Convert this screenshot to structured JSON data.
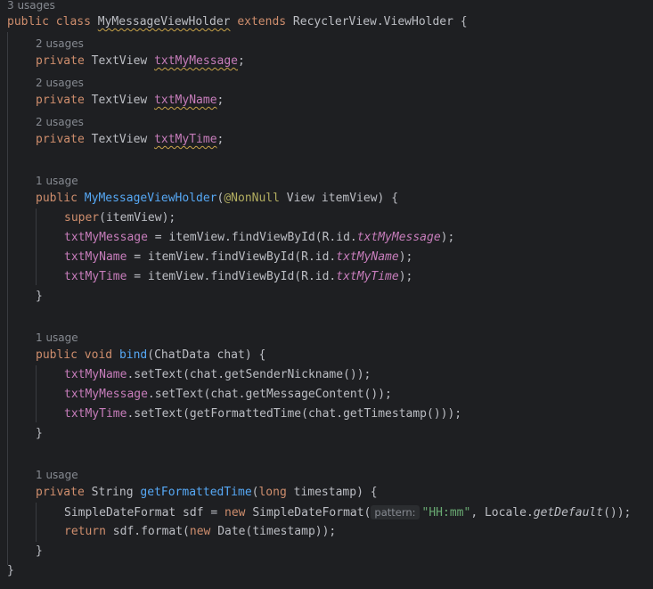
{
  "editor": {
    "language": "java",
    "colors": {
      "background": "#1e1f22",
      "text": "#bcbec4",
      "keyword": "#cf8e6d",
      "method_declaration": "#56a8f5",
      "field": "#c77dbb",
      "annotation": "#b3ae60",
      "string": "#6aab73",
      "inlay_hint": "#868a91",
      "indent_guide": "#393b40",
      "warning_underline": "#c8a34a"
    },
    "lines": [
      {
        "kind": "hint",
        "text": "3 usages"
      },
      {
        "kind": "code",
        "tokens": [
          {
            "t": "public",
            "c": "keyword"
          },
          {
            "t": " ",
            "c": "plain"
          },
          {
            "t": "class",
            "c": "keyword"
          },
          {
            "t": " ",
            "c": "plain"
          },
          {
            "t": "MyMessageViewHolder",
            "c": "type",
            "squiggle": true
          },
          {
            "t": " ",
            "c": "plain"
          },
          {
            "t": "extends",
            "c": "keyword"
          },
          {
            "t": " RecyclerView.ViewHolder {",
            "c": "plain"
          }
        ]
      },
      {
        "kind": "hint",
        "text": "2 usages"
      },
      {
        "kind": "code",
        "tokens": [
          {
            "t": "private",
            "c": "keyword"
          },
          {
            "t": " TextView ",
            "c": "plain"
          },
          {
            "t": "txtMyMessage",
            "c": "field",
            "squiggle": true
          },
          {
            "t": ";",
            "c": "plain"
          }
        ]
      },
      {
        "kind": "hint",
        "text": "2 usages"
      },
      {
        "kind": "code",
        "tokens": [
          {
            "t": "private",
            "c": "keyword"
          },
          {
            "t": " TextView ",
            "c": "plain"
          },
          {
            "t": "txtMyName",
            "c": "field",
            "squiggle": true
          },
          {
            "t": ";",
            "c": "plain"
          }
        ]
      },
      {
        "kind": "hint",
        "text": "2 usages"
      },
      {
        "kind": "code",
        "tokens": [
          {
            "t": "private",
            "c": "keyword"
          },
          {
            "t": " TextView ",
            "c": "plain"
          },
          {
            "t": "txtMyTime",
            "c": "field",
            "squiggle": true
          },
          {
            "t": ";",
            "c": "plain"
          }
        ]
      },
      {
        "kind": "hint",
        "text": "1 usage"
      },
      {
        "kind": "code",
        "tokens": [
          {
            "t": "public",
            "c": "keyword"
          },
          {
            "t": " ",
            "c": "plain"
          },
          {
            "t": "MyMessageViewHolder",
            "c": "method-decl"
          },
          {
            "t": "(",
            "c": "plain"
          },
          {
            "t": "@NonNull",
            "c": "annotation"
          },
          {
            "t": " View itemView) {",
            "c": "plain"
          }
        ]
      },
      {
        "kind": "code",
        "tokens": [
          {
            "t": "super",
            "c": "keyword"
          },
          {
            "t": "(itemView);",
            "c": "plain"
          }
        ]
      },
      {
        "kind": "code",
        "tokens": [
          {
            "t": "txtMyMessage",
            "c": "field"
          },
          {
            "t": " = itemView.findViewById(R.id.",
            "c": "plain"
          },
          {
            "t": "txtMyMessage",
            "c": "static-field"
          },
          {
            "t": ");",
            "c": "plain"
          }
        ]
      },
      {
        "kind": "code",
        "tokens": [
          {
            "t": "txtMyName",
            "c": "field"
          },
          {
            "t": " = itemView.findViewById(R.id.",
            "c": "plain"
          },
          {
            "t": "txtMyName",
            "c": "static-field"
          },
          {
            "t": ");",
            "c": "plain"
          }
        ]
      },
      {
        "kind": "code",
        "tokens": [
          {
            "t": "txtMyTime",
            "c": "field"
          },
          {
            "t": " = itemView.findViewById(R.id.",
            "c": "plain"
          },
          {
            "t": "txtMyTime",
            "c": "static-field"
          },
          {
            "t": ");",
            "c": "plain"
          }
        ]
      },
      {
        "kind": "code",
        "tokens": [
          {
            "t": "}",
            "c": "plain"
          }
        ]
      },
      {
        "kind": "hint",
        "text": "1 usage"
      },
      {
        "kind": "code",
        "tokens": [
          {
            "t": "public",
            "c": "keyword"
          },
          {
            "t": " ",
            "c": "plain"
          },
          {
            "t": "void",
            "c": "keyword"
          },
          {
            "t": " ",
            "c": "plain"
          },
          {
            "t": "bind",
            "c": "method-decl"
          },
          {
            "t": "(ChatData chat) {",
            "c": "plain"
          }
        ]
      },
      {
        "kind": "code",
        "tokens": [
          {
            "t": "txtMyName",
            "c": "field"
          },
          {
            "t": ".setText(chat.getSenderNickname());",
            "c": "plain"
          }
        ]
      },
      {
        "kind": "code",
        "tokens": [
          {
            "t": "txtMyMessage",
            "c": "field"
          },
          {
            "t": ".setText(chat.getMessageContent());",
            "c": "plain"
          }
        ]
      },
      {
        "kind": "code",
        "tokens": [
          {
            "t": "txtMyTime",
            "c": "field"
          },
          {
            "t": ".setText(getFormattedTime(chat.getTimestamp()));",
            "c": "plain"
          }
        ]
      },
      {
        "kind": "code",
        "tokens": [
          {
            "t": "}",
            "c": "plain"
          }
        ]
      },
      {
        "kind": "hint",
        "text": "1 usage"
      },
      {
        "kind": "code",
        "tokens": [
          {
            "t": "private",
            "c": "keyword"
          },
          {
            "t": " String ",
            "c": "plain"
          },
          {
            "t": "getFormattedTime",
            "c": "method-decl"
          },
          {
            "t": "(",
            "c": "plain"
          },
          {
            "t": "long",
            "c": "keyword"
          },
          {
            "t": " timestamp) {",
            "c": "plain"
          }
        ]
      },
      {
        "kind": "code",
        "tokens": [
          {
            "t": "SimpleDateFormat sdf = ",
            "c": "plain"
          },
          {
            "t": "new",
            "c": "keyword"
          },
          {
            "t": " SimpleDateFormat(",
            "c": "plain"
          },
          {
            "t": "pattern:",
            "c": "hint"
          },
          {
            "t": "\"HH:mm\"",
            "c": "string"
          },
          {
            "t": ", Locale.",
            "c": "plain"
          },
          {
            "t": "getDefault",
            "c": "static-call"
          },
          {
            "t": "());",
            "c": "plain"
          }
        ]
      },
      {
        "kind": "code",
        "tokens": [
          {
            "t": "return",
            "c": "keyword"
          },
          {
            "t": " sdf.format(",
            "c": "plain"
          },
          {
            "t": "new",
            "c": "keyword"
          },
          {
            "t": " Date(timestamp));",
            "c": "plain"
          }
        ]
      },
      {
        "kind": "code",
        "tokens": [
          {
            "t": "}",
            "c": "plain"
          }
        ]
      },
      {
        "kind": "code",
        "tokens": [
          {
            "t": "}",
            "c": "plain"
          }
        ]
      }
    ]
  }
}
